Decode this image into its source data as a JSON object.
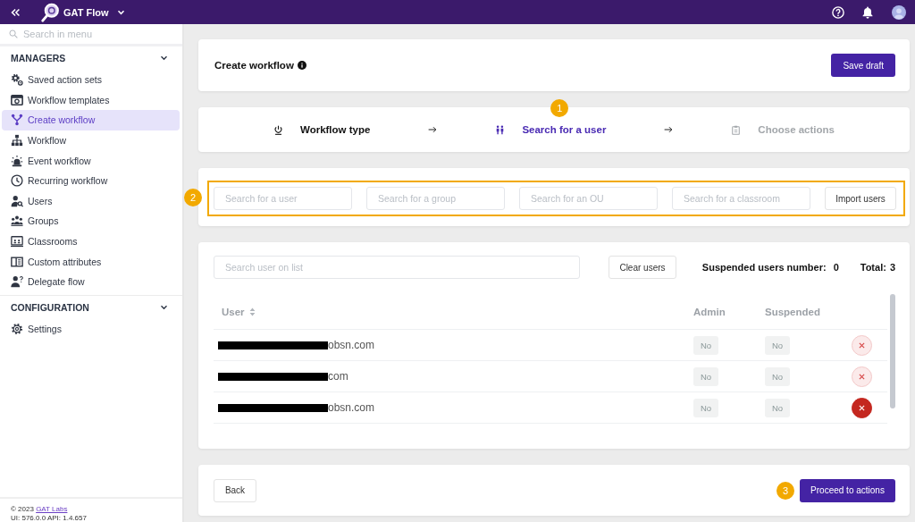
{
  "topbar": {
    "app_name": "GAT Flow"
  },
  "sidebar": {
    "search_placeholder": "Search in menu",
    "sections": [
      {
        "title": "MANAGERS",
        "expanded": true,
        "items": [
          {
            "label": "Saved action sets",
            "selected": false
          },
          {
            "label": "Workflow templates",
            "selected": false
          },
          {
            "label": "Create workflow",
            "selected": true
          },
          {
            "label": "Workflow",
            "selected": false
          },
          {
            "label": "Event workflow",
            "selected": false
          },
          {
            "label": "Recurring workflow",
            "selected": false
          },
          {
            "label": "Users",
            "selected": false
          },
          {
            "label": "Groups",
            "selected": false
          },
          {
            "label": "Classrooms",
            "selected": false
          },
          {
            "label": "Custom attributes",
            "selected": false
          },
          {
            "label": "Delegate flow",
            "selected": false
          }
        ]
      },
      {
        "title": "CONFIGURATION",
        "expanded": true,
        "items": [
          {
            "label": "Settings",
            "selected": false
          }
        ]
      }
    ],
    "footer": {
      "copyright": "© 2023",
      "link": "GAT Labs",
      "version": "UI: 576.0.0 API: 1.4.657"
    }
  },
  "header": {
    "title": "Create workflow",
    "save_button": "Save draft"
  },
  "steps": {
    "callout": "1",
    "items": [
      {
        "label": "Workflow type",
        "selected": false,
        "completed": true
      },
      {
        "label": "Search for a user",
        "selected": true,
        "completed": false
      },
      {
        "label": "Choose actions",
        "selected": false,
        "completed": false
      }
    ]
  },
  "search_bar": {
    "callout": "2",
    "highlighted": true,
    "fields": [
      {
        "placeholder": "Search for a user"
      },
      {
        "placeholder": "Search for a group"
      },
      {
        "placeholder": "Search for an OU"
      },
      {
        "placeholder": "Search for a classroom"
      }
    ],
    "import_button": "Import users"
  },
  "user_list": {
    "search_placeholder": "Search user on list",
    "clear_button": "Clear users",
    "suspended_label": "Suspended users number:",
    "suspended_count": "0",
    "total_label": "Total:",
    "total_count": "3",
    "columns": [
      {
        "label": "User",
        "sortable": true
      },
      {
        "label": "Admin",
        "sortable": false
      },
      {
        "label": "Suspended",
        "sortable": false
      }
    ],
    "rows": [
      {
        "email": "obsn.com",
        "redacted": true,
        "admin": "No",
        "suspended": "No",
        "hovered": false
      },
      {
        "email": "com",
        "redacted": true,
        "admin": "No",
        "suspended": "No",
        "hovered": false
      },
      {
        "email": "obsn.com",
        "redacted": true,
        "admin": "No",
        "suspended": "No",
        "hovered": true
      }
    ]
  },
  "actions": {
    "callout": "3",
    "back_button": "Back",
    "proceed_button": "Proceed to actions"
  }
}
